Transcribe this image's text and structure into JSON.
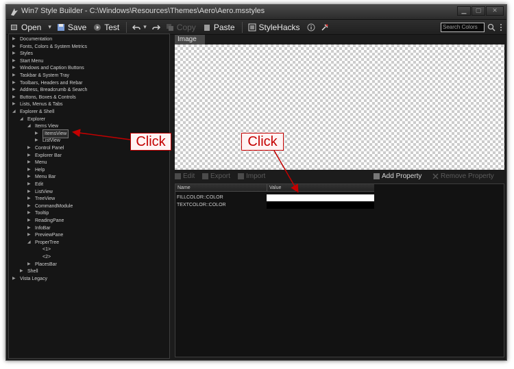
{
  "window": {
    "title": "Win7 Style Builder - C:\\Windows\\Resources\\Themes\\Aero\\Aero.msstyles",
    "controls": {
      "minimize": "▁",
      "maximize": "▢",
      "close": "✕"
    }
  },
  "toolbar": {
    "open": "Open",
    "save": "Save",
    "test": "Test",
    "copy": "Copy",
    "paste": "Paste",
    "stylehacks": "StyleHacks",
    "search_placeholder": "Search Colors"
  },
  "tree": [
    {
      "label": "Documentation",
      "level": 0,
      "state": "collapsed"
    },
    {
      "label": "Fonts, Colors & System Metrics",
      "level": 0,
      "state": "collapsed"
    },
    {
      "label": "Styles",
      "level": 0,
      "state": "collapsed"
    },
    {
      "label": "Start Menu",
      "level": 0,
      "state": "collapsed"
    },
    {
      "label": "Windows and Caption Buttons",
      "level": 0,
      "state": "collapsed"
    },
    {
      "label": "Taskbar & System Tray",
      "level": 0,
      "state": "collapsed"
    },
    {
      "label": "Toolbars, Headers and Rebar",
      "level": 0,
      "state": "collapsed"
    },
    {
      "label": "Address, Breadcrumb & Search",
      "level": 0,
      "state": "collapsed"
    },
    {
      "label": "Buttons, Boxes & Controls",
      "level": 0,
      "state": "collapsed"
    },
    {
      "label": "Lists, Menus & Tabs",
      "level": 0,
      "state": "collapsed"
    },
    {
      "label": "Explorer & Shell",
      "level": 0,
      "state": "expanded"
    },
    {
      "label": "Explorer",
      "level": 1,
      "state": "expanded"
    },
    {
      "label": "Items View",
      "level": 2,
      "state": "expanded"
    },
    {
      "label": "ItemsView",
      "level": 3,
      "state": "collapsed",
      "selected": true
    },
    {
      "label": "ListView",
      "level": 3,
      "state": "collapsed"
    },
    {
      "label": "Control Panel",
      "level": 2,
      "state": "collapsed"
    },
    {
      "label": "Explorer Bar",
      "level": 2,
      "state": "collapsed"
    },
    {
      "label": "Menu",
      "level": 2,
      "state": "collapsed"
    },
    {
      "label": "Help",
      "level": 2,
      "state": "collapsed"
    },
    {
      "label": "Menu Bar",
      "level": 2,
      "state": "collapsed"
    },
    {
      "label": "Edit",
      "level": 2,
      "state": "collapsed"
    },
    {
      "label": "ListView",
      "level": 2,
      "state": "collapsed"
    },
    {
      "label": "TreeView",
      "level": 2,
      "state": "collapsed"
    },
    {
      "label": "CommandModule",
      "level": 2,
      "state": "collapsed"
    },
    {
      "label": "Tooltip",
      "level": 2,
      "state": "collapsed"
    },
    {
      "label": "ReadingPane",
      "level": 2,
      "state": "collapsed"
    },
    {
      "label": "InfoBar",
      "level": 2,
      "state": "collapsed"
    },
    {
      "label": "PreviewPane",
      "level": 2,
      "state": "collapsed"
    },
    {
      "label": "ProperTree",
      "level": 2,
      "state": "expanded"
    },
    {
      "label": "<1>",
      "level": 3,
      "state": "leaf"
    },
    {
      "label": "<2>",
      "level": 3,
      "state": "leaf"
    },
    {
      "label": "PlacesBar",
      "level": 2,
      "state": "collapsed"
    },
    {
      "label": "Shell",
      "level": 1,
      "state": "collapsed"
    },
    {
      "label": "Vista Legacy",
      "level": 0,
      "state": "collapsed"
    }
  ],
  "image_panel": {
    "tab_label": "Image"
  },
  "property_toolbar": {
    "edit": "Edit",
    "export": "Export",
    "import": "Import",
    "add_property": "Add Property",
    "remove_property": "Remove Property"
  },
  "property_grid": {
    "columns": [
      "Name",
      "Value"
    ],
    "rows": [
      {
        "name": "FILLCOLOR::COLOR",
        "color": "#ffffff"
      },
      {
        "name": "TEXTCOLOR::COLOR",
        "color": "#000000"
      }
    ]
  },
  "annotations": [
    {
      "text": "Click",
      "points_to": "ItemsView"
    },
    {
      "text": "Click",
      "points_to": "FILLCOLOR::COLOR value"
    }
  ],
  "colors": {
    "accent_red": "#c40000",
    "panel_bg": "#151515",
    "window_bg": "#1c1c1c"
  }
}
